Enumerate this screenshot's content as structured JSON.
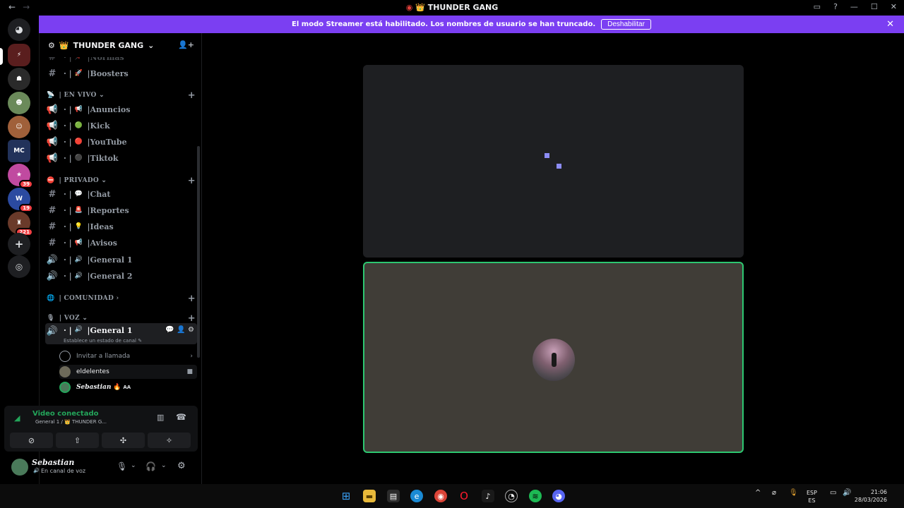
{
  "titlebar": {
    "title": "THUNDER GANG",
    "back": "←",
    "forward": "→",
    "inbox_icon": "inbox-icon",
    "help_icon": "help-icon",
    "minimize": "—",
    "maximize": "☐",
    "close": "✕"
  },
  "banner": {
    "message": "El modo Streamer está habilitado. Los nombres de usuario se han truncado.",
    "button": "Deshabilitar",
    "close": "✕"
  },
  "guilds": {
    "badges": [
      "39",
      "19",
      "221"
    ]
  },
  "server": {
    "name": "THUNDER GANG",
    "crown": "👑",
    "chevron": "⌄"
  },
  "channels": {
    "top": [
      {
        "emoji": "📌",
        "name": "Normas"
      },
      {
        "emoji": "🚀",
        "name": "Boosters"
      }
    ],
    "en_vivo": {
      "label": "| EN VIVO",
      "items": [
        {
          "emoji": "📢",
          "name": "Anuncios"
        },
        {
          "emoji": "🟢",
          "name": "Kick"
        },
        {
          "emoji": "🔴",
          "name": "YouTube"
        },
        {
          "emoji": "⚫",
          "name": "Tiktok"
        }
      ]
    },
    "privado": {
      "label": "| PRIVADO",
      "items": [
        {
          "emoji": "💬",
          "name": "Chat"
        },
        {
          "emoji": "🚨",
          "name": "Reportes"
        },
        {
          "emoji": "💡",
          "name": "Ideas"
        },
        {
          "emoji": "📢",
          "name": "Avisos"
        },
        {
          "emoji": "🔊",
          "name": "General 1"
        },
        {
          "emoji": "🔊",
          "name": "General 2"
        }
      ]
    },
    "comunidad": {
      "label": "| COMUNIDAD"
    },
    "voz": {
      "label": "| VOZ",
      "active": {
        "emoji": "🔊",
        "name": "General 1",
        "status": "Establece un estado de canal ✎"
      }
    },
    "voice_rows": {
      "invite": "Invitar a llamada",
      "user1": "eldelentes",
      "user2": "Sebastian",
      "user2_tag": "AA"
    }
  },
  "voice_panel": {
    "title": "Video conectado",
    "subtitle": "General 1 / 👑 THUNDER G...",
    "buttons": [
      "camera-off-icon",
      "screen-share-icon",
      "activities-icon",
      "soundboard-icon"
    ]
  },
  "user": {
    "name": "Sebastian",
    "status": "En canal de voz"
  },
  "taskbar": {
    "lang1": "ESP",
    "lang2": "ES",
    "time": "21:06",
    "date": "28/03/2026"
  },
  "colors": {
    "banner": "#7b3ff2",
    "speaking_border": "#2dc770",
    "connected_green": "#23a55a"
  }
}
